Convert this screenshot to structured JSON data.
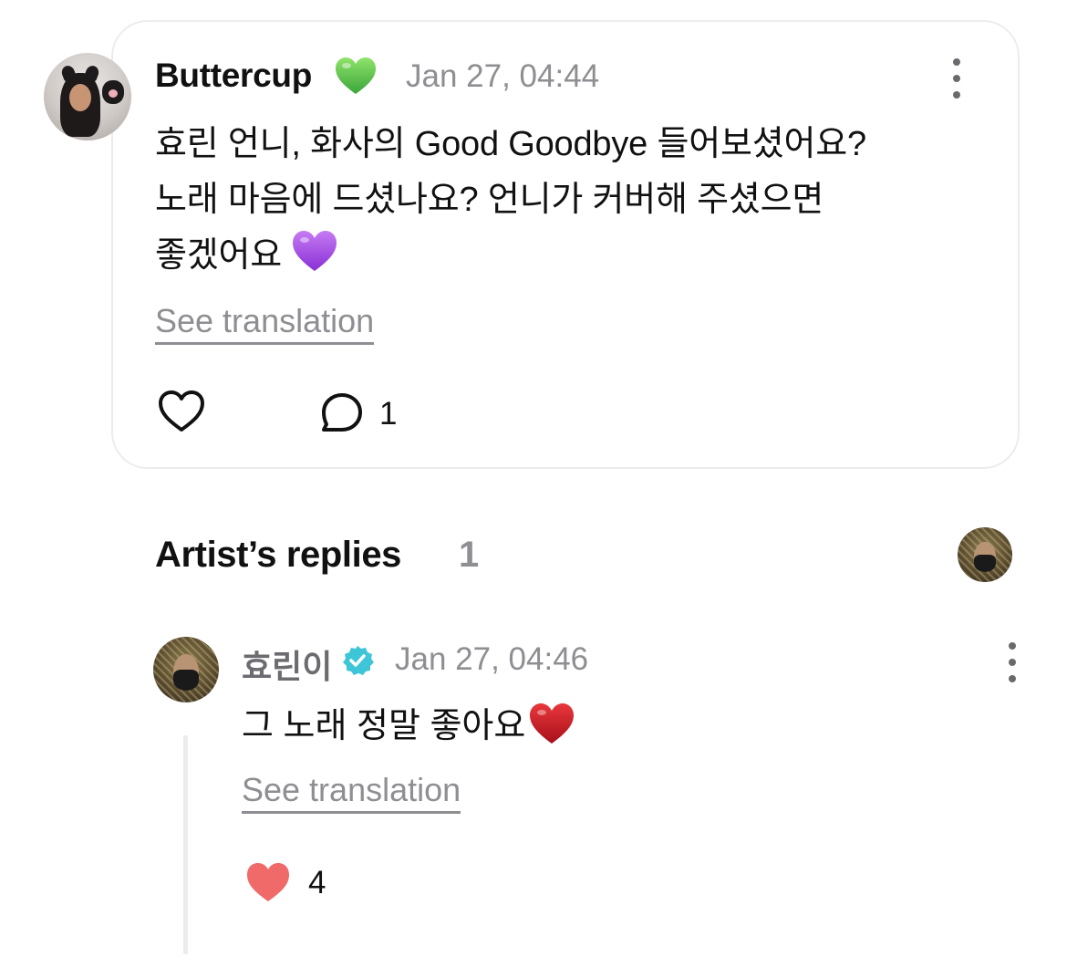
{
  "comment": {
    "author": "Buttercup",
    "author_emoji": "green-heart",
    "timestamp": "Jan 27, 04:44",
    "lines": [
      "효린 언니, 화사의 Good Goodbye 들어보셨어요?",
      "노래 마음에 드셨나요? 언니가 커버해 주셨으면",
      "좋겠어요"
    ],
    "trailing_emoji": "purple-heart",
    "see_translation": "See translation",
    "comment_count": "1"
  },
  "replies_section": {
    "title": "Artist’s replies",
    "count": "1"
  },
  "reply": {
    "author": "효린이",
    "verified": true,
    "timestamp": "Jan 27, 04:46",
    "text": "그 노래 정말 좋아요",
    "trailing_emoji": "red-heart",
    "see_translation": "See translation",
    "like_count": "4"
  },
  "colors": {
    "text_primary": "#111111",
    "text_secondary": "#8e8e93",
    "card_border": "#ececec",
    "like_red": "#f06a6a",
    "verified_teal": "#3ec6d8"
  },
  "icons": [
    "more-vertical-icon",
    "heart-outline-icon",
    "comment-bubble-icon",
    "verified-badge-icon",
    "heart-filled-icon"
  ]
}
